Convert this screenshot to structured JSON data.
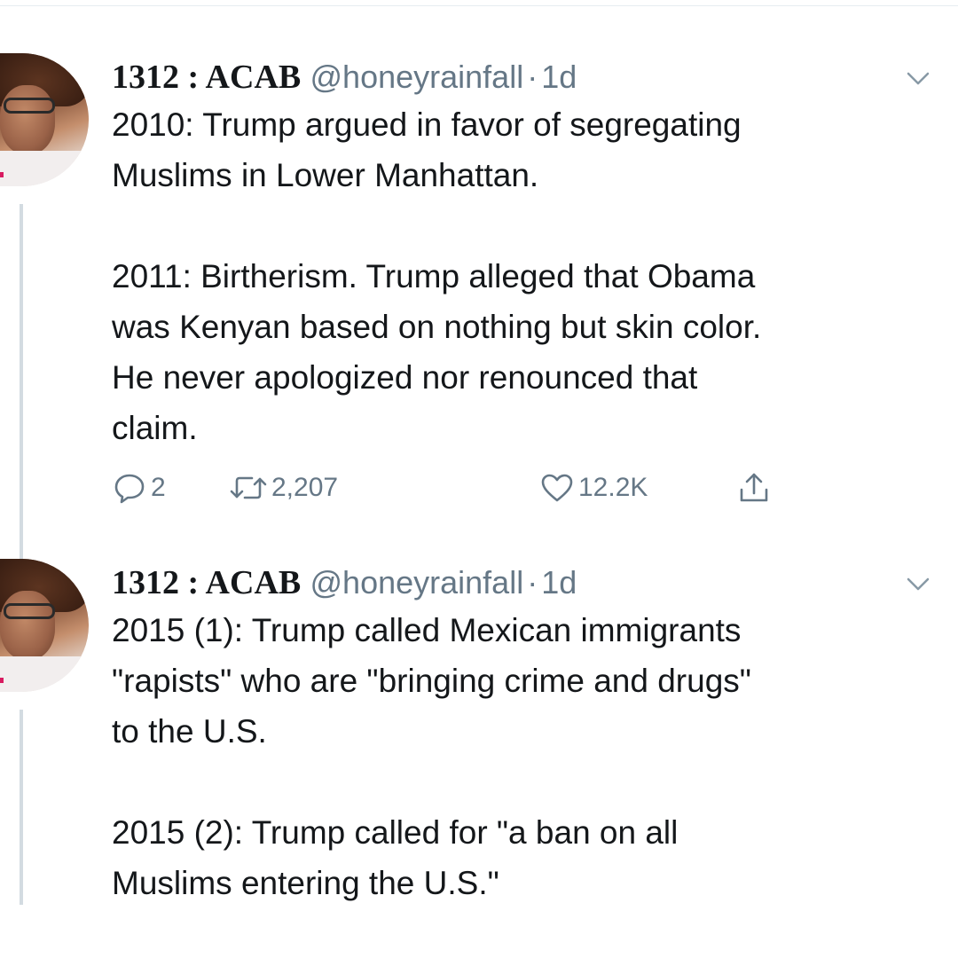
{
  "tweets": [
    {
      "display_name": "1312 : ACAB",
      "handle": "@honeyrainfall",
      "separator": "·",
      "time": "1d",
      "text": "2010: Trump argued in favor of segregating\nMuslims in Lower Manhattan.\n\n2011: Birtherism. Trump alleged that Obama\nwas Kenyan based on nothing but skin color.\nHe never apologized nor renounced that\nclaim.",
      "replies": "2",
      "retweets": "2,207",
      "likes": "12.2K"
    },
    {
      "display_name": "1312 : ACAB",
      "handle": "@honeyrainfall",
      "separator": "·",
      "time": "1d",
      "text": "2015 (1): Trump called Mexican immigrants\n\"rapists\" who are \"bringing crime and drugs\"\nto the U.S.\n\n2015 (2): Trump called for \"a ban on all\nMuslims entering the U.S.\""
    }
  ],
  "icons": {
    "reply": "reply-icon",
    "retweet": "retweet-icon",
    "like": "heart-icon",
    "share": "share-icon",
    "menu": "chevron-down-icon"
  },
  "colors": {
    "text": "#14171a",
    "secondary": "#657786",
    "thread_line": "#d3dbe1"
  }
}
